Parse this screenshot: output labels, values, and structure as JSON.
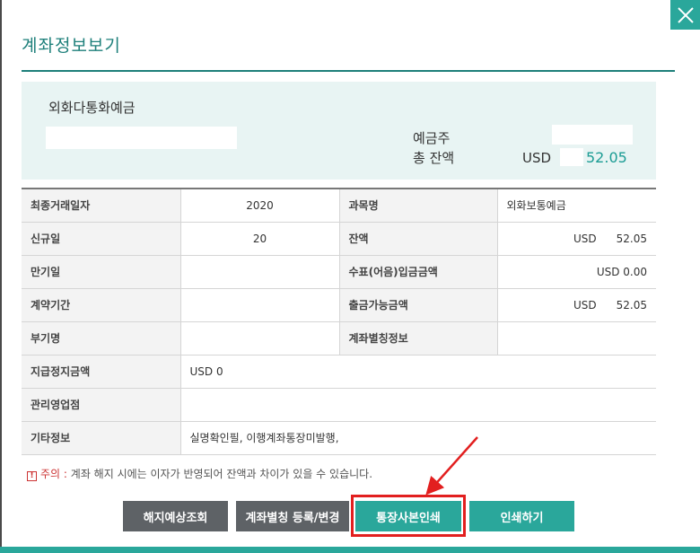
{
  "dialog": {
    "title": "계좌정보보기"
  },
  "summary": {
    "account_type": "외화다통화예금",
    "owner_label": "예금주",
    "total_label": "총 잔액",
    "total_currency": "USD",
    "total_amount": "52.05"
  },
  "table": {
    "r1": {
      "l1": "최종거래일자",
      "v1": "2020",
      "l2": "과목명",
      "v2": "외화보통예금"
    },
    "r2": {
      "l1": "신규일",
      "v1": "20",
      "l2": "잔액",
      "v2a": "USD",
      "v2b": "52.05"
    },
    "r3": {
      "l1": "만기일",
      "v1": "",
      "l2": "수표(어음)입금금액",
      "v2": "USD 0.00"
    },
    "r4": {
      "l1": "계약기간",
      "v1": "",
      "l2": "출금가능금액",
      "v2a": "USD",
      "v2b": "52.05"
    },
    "r5": {
      "l1": "부기명",
      "v1": "",
      "l2": "계좌별칭정보",
      "v2": ""
    },
    "r6": {
      "l1": "지급정지금액",
      "v1": "USD 0"
    },
    "r7": {
      "l1": "관리영업점",
      "v1": ""
    },
    "r8": {
      "l1": "기타정보",
      "v1": "실명확인필,   이행계좌통장미발행,"
    }
  },
  "notice": {
    "label": "주의 :",
    "text": "계좌 해지 시에는 이자가 반영되어 잔액과 차이가 있을 수 있습니다."
  },
  "buttons": {
    "cancel_inquiry": "해지예상조회",
    "alias_register": "계좌별칭 등록/변경",
    "passbook_print": "통장사본인쇄",
    "print": "인쇄하기"
  },
  "colors": {
    "accent": "#2aa79b",
    "title": "#1d7f7a",
    "highlight": "#e21f1f"
  },
  "icons": {
    "close": "close-icon",
    "warning": "warning-icon"
  }
}
